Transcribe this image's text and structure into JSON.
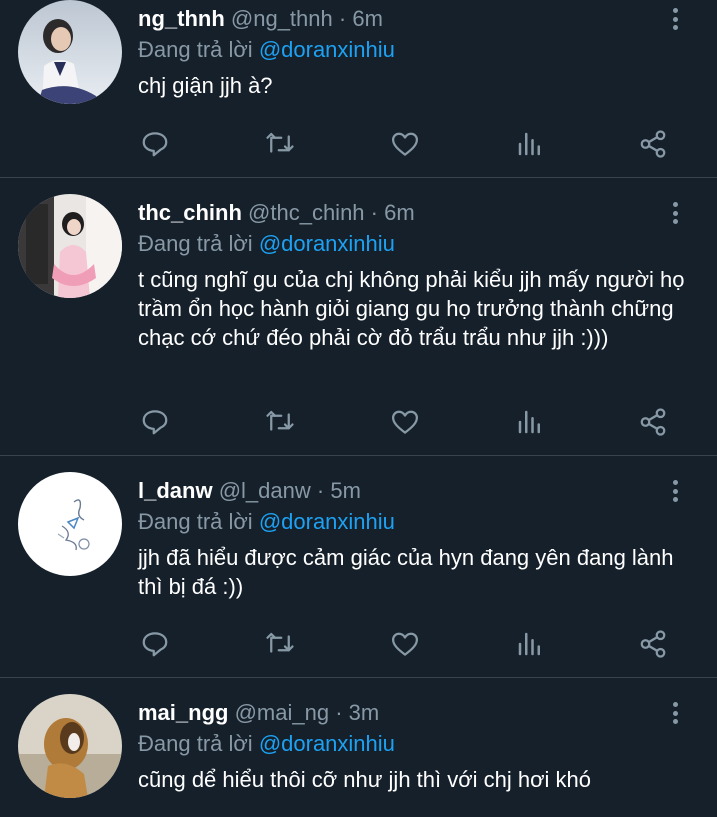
{
  "icons": {
    "reply": "reply-icon",
    "retweet": "retweet-icon",
    "like": "heart-icon",
    "stats": "stats-icon",
    "share": "share-icon",
    "more": "more-vertical-icon"
  },
  "colors": {
    "background": "#15202b",
    "divider": "#38444d",
    "secondary_text": "#8899a6",
    "mention": "#1da1f2"
  },
  "tweets": [
    {
      "display_name": "ng_thnh",
      "handle": "@ng_thnh",
      "separator": "·",
      "time": "6m",
      "reply_prefix": "Đang trả lời ",
      "reply_to": "@doranxinhiu",
      "text": "chj giận jjh à?"
    },
    {
      "display_name": "thc_chinh",
      "handle": "@thc_chinh",
      "separator": "·",
      "time": "6m",
      "reply_prefix": "Đang trả lời ",
      "reply_to": "@doranxinhiu",
      "text": "t cũng nghĩ gu của chj không phải kiểu jjh mấy người họ trầm ổn học hành giỏi giang gu họ trưởng thành chững chạc cớ chứ đéo phải cờ đỏ trẩu trẩu như jjh :)))"
    },
    {
      "display_name": "l_danw",
      "handle": "@l_danw",
      "separator": "·",
      "time": "5m",
      "reply_prefix": "Đang trả lời ",
      "reply_to": "@doranxinhiu",
      "text": "jjh đã hiểu được cảm giác của hyn đang yên đang lành thì bị đá :))"
    },
    {
      "display_name": "mai_ngg",
      "handle": "@mai_ng",
      "separator": "·",
      "time": "3m",
      "reply_prefix": "Đang trả lời ",
      "reply_to": "@doranxinhiu",
      "text": "cũng dể hiểu thôi cỡ như jjh thì với chj hơi khó"
    }
  ]
}
